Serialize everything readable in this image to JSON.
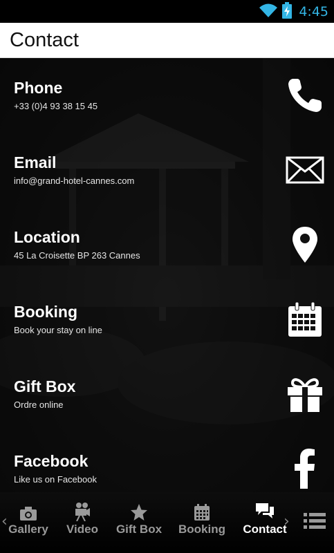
{
  "status_bar": {
    "time": "4:45",
    "icons": [
      "wifi-icon",
      "battery-charging-icon"
    ]
  },
  "header": {
    "title": "Contact"
  },
  "contacts": [
    {
      "title": "Phone",
      "subtitle": "+33 (0)4 93 38 15 45",
      "icon": "phone-icon"
    },
    {
      "title": "Email",
      "subtitle": "info@grand-hotel-cannes.com",
      "icon": "envelope-icon"
    },
    {
      "title": "Location",
      "subtitle": "45 La Croisette BP 263 Cannes",
      "icon": "map-pin-icon"
    },
    {
      "title": "Booking",
      "subtitle": "Book your stay on line",
      "icon": "calendar-icon"
    },
    {
      "title": "Gift Box",
      "subtitle": "Ordre online",
      "icon": "gift-icon"
    },
    {
      "title": "Facebook",
      "subtitle": "Like us on Facebook",
      "icon": "facebook-icon"
    }
  ],
  "bottom_nav": {
    "tabs": [
      {
        "label": "Gallery",
        "icon": "camera-icon",
        "active": false
      },
      {
        "label": "Video",
        "icon": "video-camera-icon",
        "active": false
      },
      {
        "label": "Gift Box",
        "icon": "star-icon",
        "active": false
      },
      {
        "label": "Booking",
        "icon": "calendar-icon",
        "active": false
      },
      {
        "label": "Contact",
        "icon": "chat-bubbles-icon",
        "active": true
      }
    ],
    "prev_arrow": "‹",
    "next_arrow": "›"
  },
  "colors": {
    "status_time": "#33b5e5",
    "active_tab": "#ffffff",
    "inactive_tab": "#9a9a9a"
  }
}
